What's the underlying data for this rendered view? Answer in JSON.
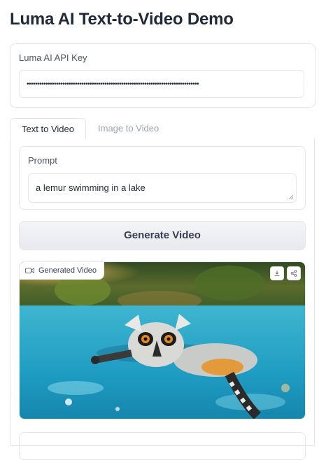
{
  "page": {
    "title": "Luma AI Text-to-Video Demo"
  },
  "api_key": {
    "label": "Luma AI API Key",
    "value": "••••••••••••••••••••••••••••••••••••••••••••••••••••••••••••••••••••••••••••••••••"
  },
  "tabs": [
    {
      "label": "Text to Video",
      "active": true
    },
    {
      "label": "Image to Video",
      "active": false
    }
  ],
  "prompt": {
    "label": "Prompt",
    "value": "a lemur swimming in a lake"
  },
  "generate_button": {
    "label": "Generate Video"
  },
  "video": {
    "label": "Generated Video",
    "label_icon": "video-camera-icon",
    "actions": [
      "download-icon",
      "share-icon"
    ]
  },
  "colors": {
    "border": "#e5e7eb",
    "water": "#2aa7c8",
    "accent": "#1f2937"
  }
}
